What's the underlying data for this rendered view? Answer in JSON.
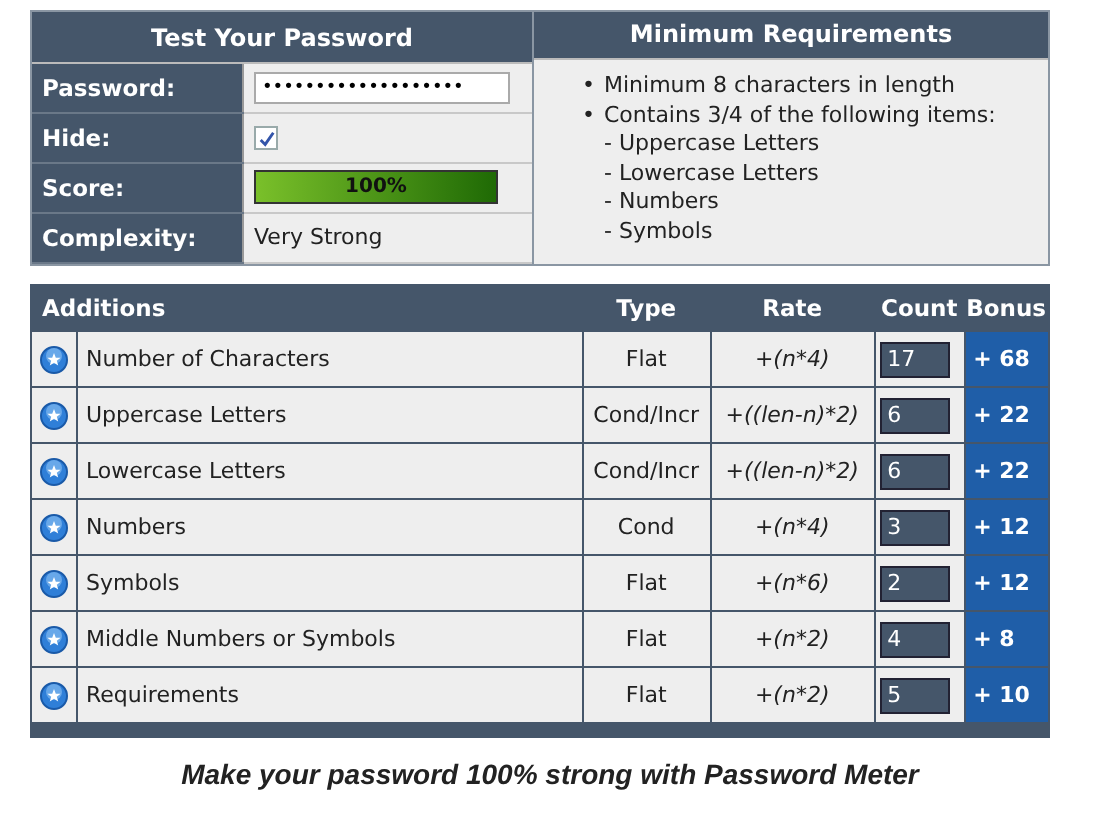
{
  "test_panel": {
    "title": "Test Your Password",
    "password": {
      "label": "Password:",
      "value": "•••••••••••••••••••"
    },
    "hide": {
      "label": "Hide:",
      "checked": true
    },
    "score": {
      "label": "Score:",
      "level": 1,
      "reading": "100%"
    },
    "complexity": {
      "label": "Complexity:",
      "value": "Very Strong"
    }
  },
  "requirements_panel": {
    "title": "Minimum Requirements",
    "items": [
      {
        "bullet": "•",
        "text": "Minimum 8 characters in length"
      },
      {
        "bullet": "•",
        "text": "Contains 3/4 of the following items:",
        "children": [
          "- Uppercase Letters",
          "- Lowercase Letters",
          "- Numbers",
          "- Symbols"
        ]
      }
    ]
  },
  "additions": {
    "columns": [
      "Additions",
      "Type",
      "Rate",
      "Count",
      "Bonus"
    ],
    "rows": [
      {
        "name": "Number of Characters",
        "type": "Flat",
        "rate": "+(n*4)",
        "count": "17",
        "bonus": "+ 68"
      },
      {
        "name": "Uppercase Letters",
        "type": "Cond/Incr",
        "rate": "+((len-n)*2)",
        "count": "6",
        "bonus": "+ 22"
      },
      {
        "name": "Lowercase Letters",
        "type": "Cond/Incr",
        "rate": "+((len-n)*2)",
        "count": "6",
        "bonus": "+ 22"
      },
      {
        "name": "Numbers",
        "type": "Cond",
        "rate": "+(n*4)",
        "count": "3",
        "bonus": "+ 12"
      },
      {
        "name": "Symbols",
        "type": "Flat",
        "rate": "+(n*6)",
        "count": "2",
        "bonus": "+ 12"
      },
      {
        "name": "Middle Numbers or Symbols",
        "type": "Flat",
        "rate": "+(n*2)",
        "count": "4",
        "bonus": "+ 8"
      },
      {
        "name": "Requirements",
        "type": "Flat",
        "rate": "+(n*2)",
        "count": "5",
        "bonus": "+ 10"
      }
    ]
  },
  "caption": "Make your password 100% strong with Password Meter"
}
